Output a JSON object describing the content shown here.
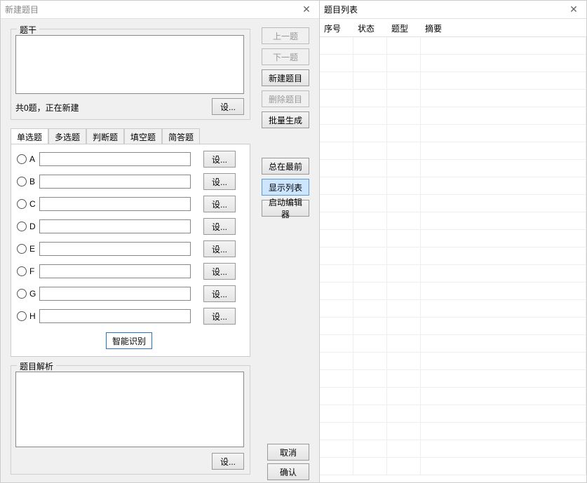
{
  "left_panel": {
    "title": "新建题目",
    "stem": {
      "legend": "题干",
      "value": "",
      "status": "共0题，正在新建",
      "set_btn": "设..."
    },
    "tabs": {
      "items": [
        "单选题",
        "多选题",
        "判断题",
        "填空题",
        "简答题"
      ],
      "active_index": 0,
      "options": [
        {
          "label": "A",
          "value": "",
          "set_btn": "设..."
        },
        {
          "label": "B",
          "value": "",
          "set_btn": "设..."
        },
        {
          "label": "C",
          "value": "",
          "set_btn": "设..."
        },
        {
          "label": "D",
          "value": "",
          "set_btn": "设..."
        },
        {
          "label": "E",
          "value": "",
          "set_btn": "设..."
        },
        {
          "label": "F",
          "value": "",
          "set_btn": "设..."
        },
        {
          "label": "G",
          "value": "",
          "set_btn": "设..."
        },
        {
          "label": "H",
          "value": "",
          "set_btn": "设..."
        }
      ],
      "smart_recognize": "智能识别"
    },
    "analysis": {
      "legend": "题目解析",
      "value": "",
      "set_btn": "设..."
    },
    "side_buttons": {
      "prev": "上一题",
      "next": "下一题",
      "new": "新建题目",
      "delete": "删除题目",
      "batch": "批量生成",
      "always_top": "总在最前",
      "show_list": "显示列表",
      "launch_editor": "启动编辑器"
    },
    "cancel": "取消",
    "confirm": "确认"
  },
  "right_panel": {
    "title": "题目列表",
    "columns": [
      "序号",
      "状态",
      "题型",
      "摘要"
    ],
    "rows": []
  }
}
